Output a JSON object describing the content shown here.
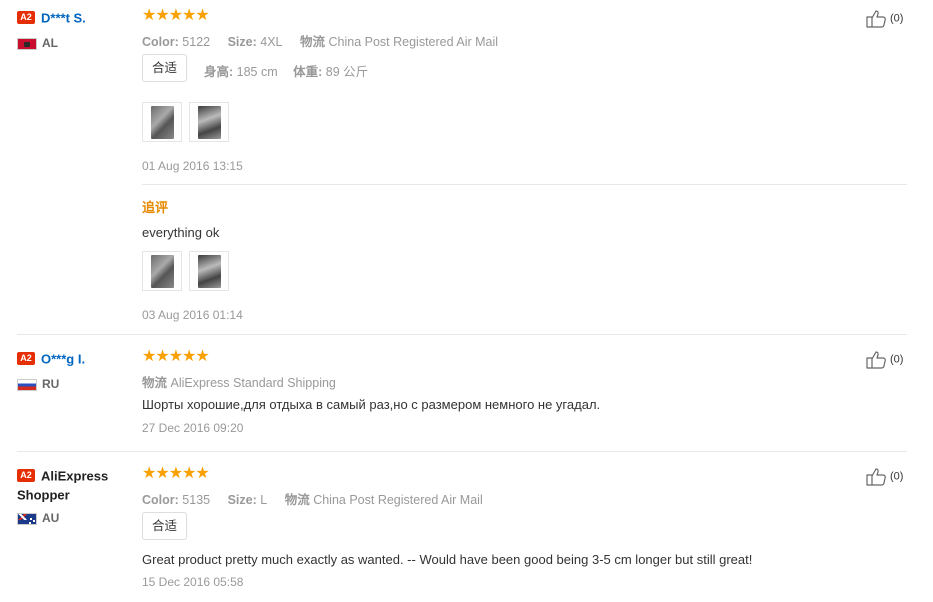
{
  "reviews": [
    {
      "badge": "A2",
      "user": "D***t S.",
      "country": "AL",
      "stars": "★★★★★",
      "color_label": "Color:",
      "color_value": "5122",
      "size_label": "Size:",
      "size_value": "4XL",
      "shipping_label": "物流",
      "shipping_value": "China Post Registered Air Mail",
      "fit": "合适",
      "height_label": "身高:",
      "height_value": "185 cm",
      "weight_label": "体重:",
      "weight_value": "89 公斤",
      "date": "01 Aug 2016 13:15",
      "likes": "(0)",
      "followup": {
        "title": "追评",
        "text": "everything ok",
        "date": "03 Aug 2016 01:14"
      }
    },
    {
      "badge": "A2",
      "user": "O***g I.",
      "country": "RU",
      "stars": "★★★★★",
      "shipping_label": "物流",
      "shipping_value": "AliExpress Standard Shipping",
      "text": "Шорты хорошие,для отдыха в самый раз,но с размером немного не угадал.",
      "date": "27 Dec 2016 09:20",
      "likes": "(0)"
    },
    {
      "badge": "A2",
      "user": "AliExpress Shopper",
      "country": "AU",
      "stars": "★★★★★",
      "color_label": "Color:",
      "color_value": "5135",
      "size_label": "Size:",
      "size_value": "L",
      "shipping_label": "物流",
      "shipping_value": "China Post Registered Air Mail",
      "fit": "合适",
      "text": "Great product pretty much exactly as wanted. -- Would have been good being 3-5 cm longer but still great!",
      "date": "15 Dec 2016 05:58",
      "likes": "(0)"
    }
  ],
  "colors": {
    "accent_red": "#e62e04",
    "star": "#f8a100",
    "link": "#0066c0",
    "followup": "#e58a00"
  }
}
